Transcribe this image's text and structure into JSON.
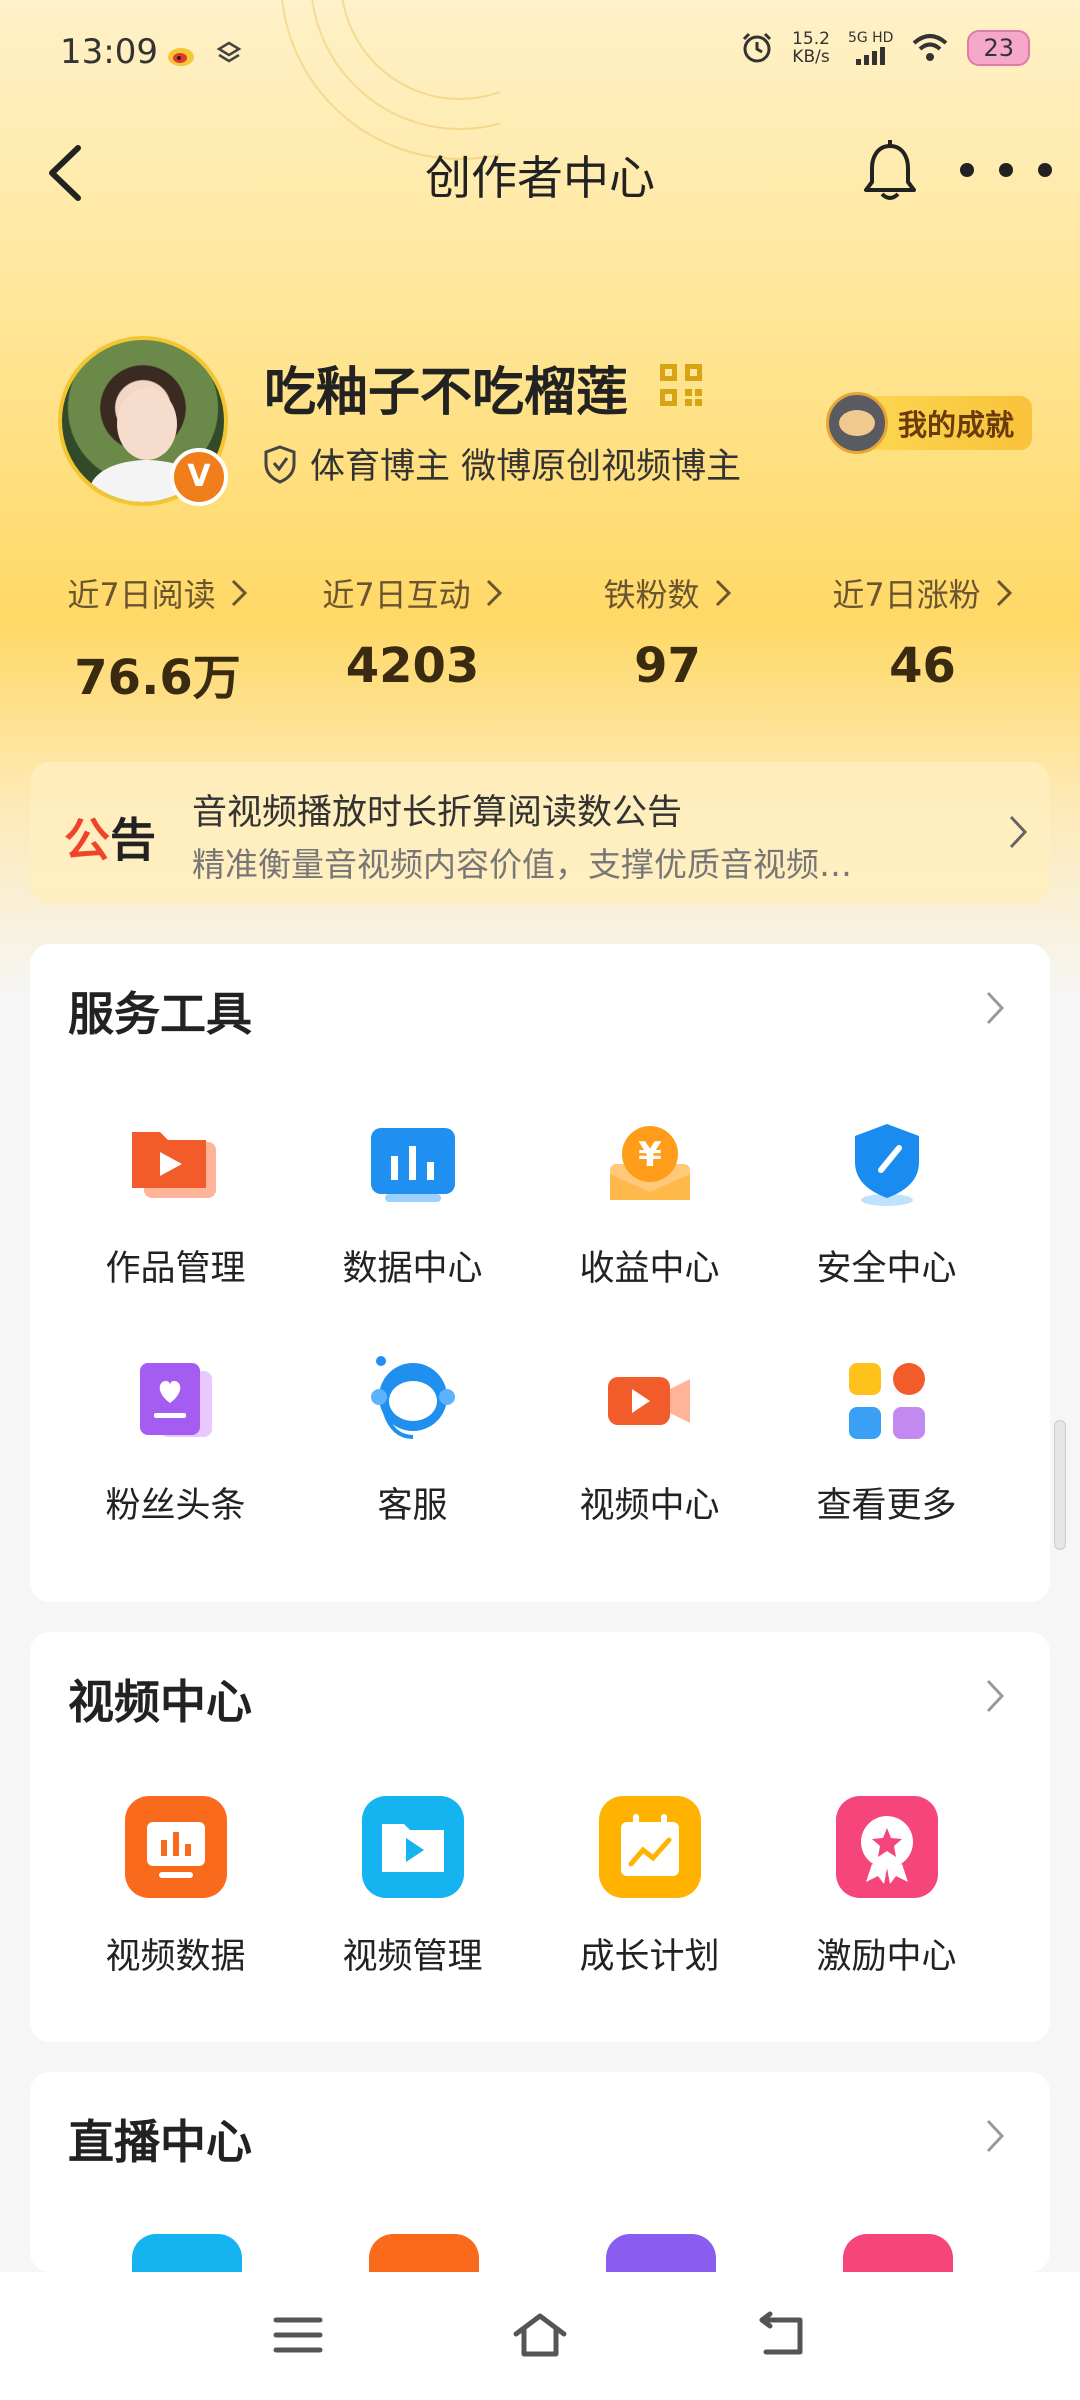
{
  "status_bar": {
    "time": "13:09",
    "speed_value": "15.2",
    "speed_unit": "KB/s",
    "network": "5G HD",
    "battery": "23"
  },
  "header": {
    "title": "创作者中心"
  },
  "profile": {
    "name": "吃釉子不吃榴莲",
    "tagline": "体育博主 微博原创视频博主",
    "achievement_label": "我的成就",
    "verified_mark": "V"
  },
  "stats": [
    {
      "label": "近7日阅读",
      "value": "76.6万"
    },
    {
      "label": "近7日互动",
      "value": "4203"
    },
    {
      "label": "铁粉数",
      "value": "97"
    },
    {
      "label": "近7日涨粉",
      "value": "46"
    }
  ],
  "notice": {
    "tag_part1": "公",
    "tag_part2": "告",
    "title": "音视频播放时长折算阅读数公告",
    "subtitle": "精准衡量音视频内容价值，支撑优质音视频…"
  },
  "service_tools": {
    "title": "服务工具",
    "items": [
      {
        "label": "作品管理",
        "icon": "works-folder-icon"
      },
      {
        "label": "数据中心",
        "icon": "data-chart-icon"
      },
      {
        "label": "收益中心",
        "icon": "income-coin-icon"
      },
      {
        "label": "安全中心",
        "icon": "security-shield-icon"
      },
      {
        "label": "粉丝头条",
        "icon": "fans-headline-icon"
      },
      {
        "label": "客服",
        "icon": "customer-service-icon"
      },
      {
        "label": "视频中心",
        "icon": "video-camera-icon"
      },
      {
        "label": "查看更多",
        "icon": "more-apps-icon"
      }
    ]
  },
  "video_center": {
    "title": "视频中心",
    "items": [
      {
        "label": "视频数据",
        "icon": "video-data-icon"
      },
      {
        "label": "视频管理",
        "icon": "video-manage-icon"
      },
      {
        "label": "成长计划",
        "icon": "growth-plan-icon"
      },
      {
        "label": "激励中心",
        "icon": "incentive-medal-icon"
      }
    ]
  },
  "live_center": {
    "title": "直播中心"
  },
  "colors": {
    "accent_orange": "#f07e1a",
    "notice_red": "#f0442a",
    "header_gold": "#ffd866"
  }
}
